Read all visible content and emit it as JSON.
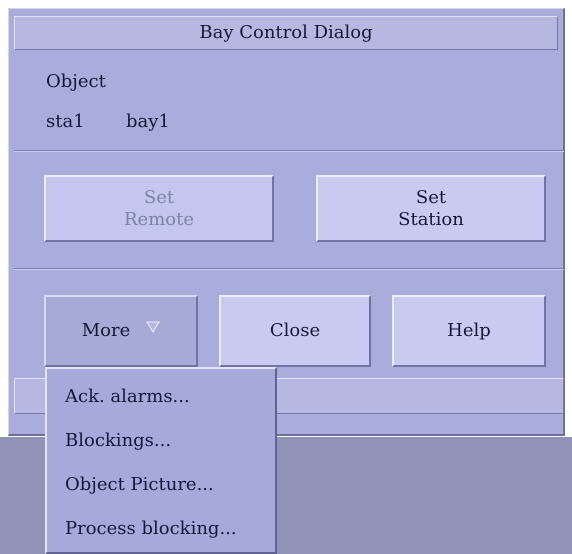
{
  "dialog": {
    "title": "Bay Control Dialog",
    "object_label": "Object",
    "station": "sta1",
    "bay": "bay1"
  },
  "buttons": {
    "set_remote": [
      "Set",
      "Remote"
    ],
    "set_station": [
      "Set",
      "Station"
    ],
    "more": "More",
    "close": "Close",
    "help": "Help"
  },
  "more_menu": {
    "items": [
      "Ack. alarms...",
      "Blockings...",
      "Object Picture...",
      "Process blocking..."
    ]
  }
}
